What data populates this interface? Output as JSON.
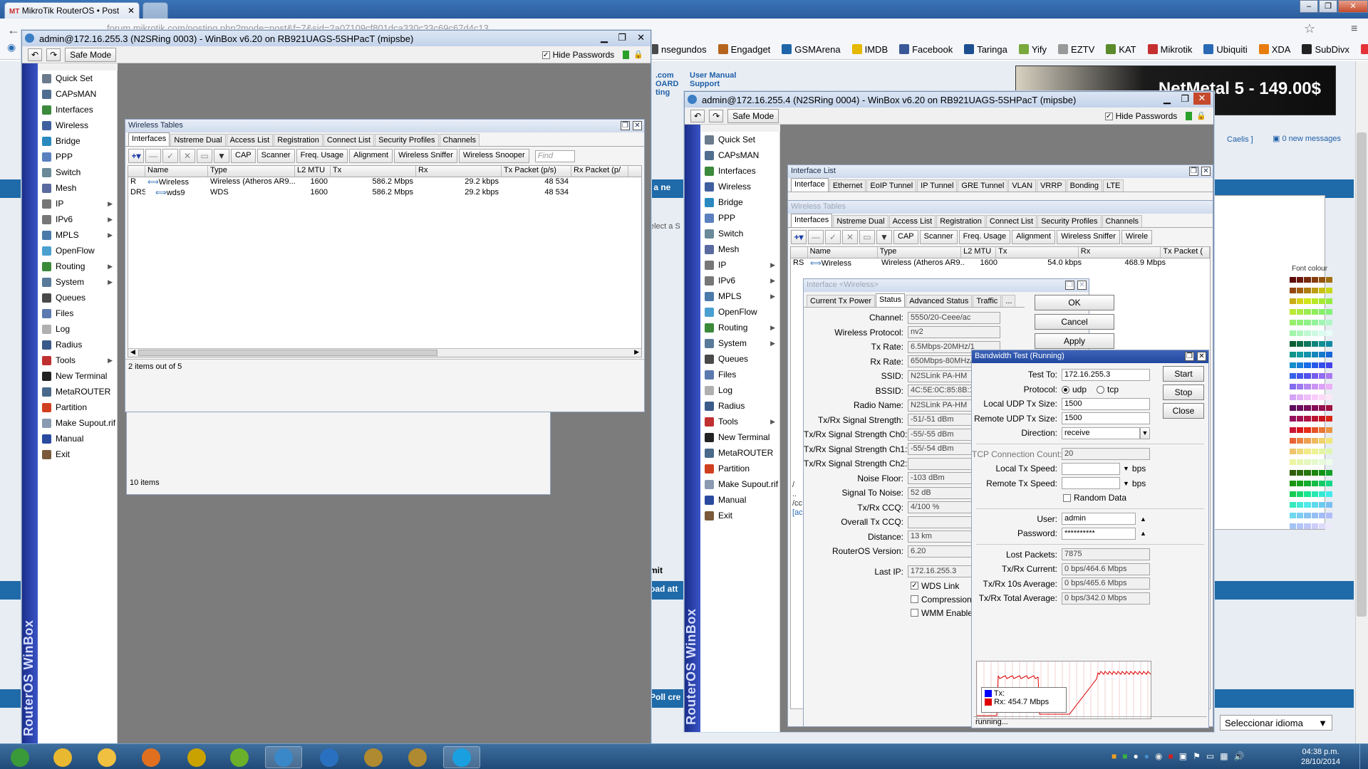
{
  "browser": {
    "tabs": [
      {
        "label": "MikroTik RouterOS • Post"
      }
    ],
    "url_partial": "forum.mikrotik.com/posting.php?mode=post&f=7&sid=2a07109cf801dca330c33c69c67d4c13",
    "bookmarks": [
      "nsegundos",
      "Engadget",
      "GSMArena",
      "IMDB",
      "Facebook",
      "Taringa",
      "Yify",
      "EZTV",
      "KAT",
      "Mikrotik",
      "Ubiquiti",
      "XDA",
      "SubDivx",
      "eBay"
    ],
    "bookmark_colors": [
      "#4a4a4a",
      "#b5651d",
      "#1f66a8",
      "#e6b800",
      "#3b5998",
      "#1d4f91",
      "#79a83c",
      "#999",
      "#5a8a2a",
      "#c62f2f",
      "#2a6ab5",
      "#e87d0d",
      "#222",
      "#e53238"
    ]
  },
  "webpage": {
    "links": [
      ".com",
      "OARD",
      "ting",
      "User Manual",
      "Support"
    ],
    "banner_text": "NetMetal 5 - 149.00$",
    "right_header": "Caelis ]",
    "messages": "0 new messages",
    "font_colour_label": "Font colour",
    "left_fragments": [
      "t a ne",
      "elect a S",
      "mit",
      "oad att",
      "Poll cre"
    ],
    "language_select": "Seleccionar idioma"
  },
  "winbox1": {
    "title": "admin@172.16.255.3 (N2SRing 0003) - WinBox v6.20 on RB921UAGS-5SHPacT (mipsbe)",
    "safe_mode": "Safe Mode",
    "hide_passwords": "Hide Passwords",
    "side_label": "RouterOS WinBox",
    "bg_window_status": "10 items"
  },
  "winbox2": {
    "title": "admin@172.16.255.4 (N2SRing 0004) - WinBox v6.20 on RB921UAGS-5SHPacT (mipsbe)",
    "safe_mode": "Safe Mode",
    "hide_passwords": "Hide Passwords",
    "side_label": "RouterOS WinBox"
  },
  "menu_items": [
    {
      "label": "Quick Set",
      "icon": "quick-set-icon",
      "color": "#6b7b8c",
      "arrow": false
    },
    {
      "label": "CAPsMAN",
      "icon": "capsman-icon",
      "color": "#4f6d8f",
      "arrow": false
    },
    {
      "label": "Interfaces",
      "icon": "interfaces-icon",
      "color": "#3c8a3c",
      "arrow": false
    },
    {
      "label": "Wireless",
      "icon": "wireless-icon",
      "color": "#3f5f9f",
      "arrow": false
    },
    {
      "label": "Bridge",
      "icon": "bridge-icon",
      "color": "#2a8ac0",
      "arrow": false
    },
    {
      "label": "PPP",
      "icon": "ppp-icon",
      "color": "#5a80c0",
      "arrow": false
    },
    {
      "label": "Switch",
      "icon": "switch-icon",
      "color": "#6a8a9a",
      "arrow": false
    },
    {
      "label": "Mesh",
      "icon": "mesh-icon",
      "color": "#5a6aa0",
      "arrow": false
    },
    {
      "label": "IP",
      "icon": "ip-icon",
      "color": "#777777",
      "arrow": true
    },
    {
      "label": "IPv6",
      "icon": "ipv6-icon",
      "color": "#777777",
      "arrow": true
    },
    {
      "label": "MPLS",
      "icon": "mpls-icon",
      "color": "#4a7aaa",
      "arrow": true
    },
    {
      "label": "OpenFlow",
      "icon": "openflow-icon",
      "color": "#4aa0d0",
      "arrow": false
    },
    {
      "label": "Routing",
      "icon": "routing-icon",
      "color": "#3a8a3a",
      "arrow": true
    },
    {
      "label": "System",
      "icon": "system-icon",
      "color": "#5a7a9a",
      "arrow": true
    },
    {
      "label": "Queues",
      "icon": "queues-icon",
      "color": "#4a4a4a",
      "arrow": false
    },
    {
      "label": "Files",
      "icon": "files-icon",
      "color": "#5a7ab0",
      "arrow": false
    },
    {
      "label": "Log",
      "icon": "log-icon",
      "color": "#b0b0b0",
      "arrow": false
    },
    {
      "label": "Radius",
      "icon": "radius-icon",
      "color": "#3a5a8a",
      "arrow": false
    },
    {
      "label": "Tools",
      "icon": "tools-icon",
      "color": "#c03030",
      "arrow": true
    },
    {
      "label": "New Terminal",
      "icon": "terminal-icon",
      "color": "#222222",
      "arrow": false
    },
    {
      "label": "MetaROUTER",
      "icon": "metarouter-icon",
      "color": "#4a6a8a",
      "arrow": false
    },
    {
      "label": "Partition",
      "icon": "partition-icon",
      "color": "#d04020",
      "arrow": false
    },
    {
      "label": "Make Supout.rif",
      "icon": "supout-icon",
      "color": "#8a9ab0",
      "arrow": false
    },
    {
      "label": "Manual",
      "icon": "manual-icon",
      "color": "#2a4aa0",
      "arrow": false
    },
    {
      "label": "Exit",
      "icon": "exit-icon",
      "color": "#7a5a3a",
      "arrow": false
    }
  ],
  "wireless_tables_1": {
    "title": "Wireless Tables",
    "tabs": [
      "Interfaces",
      "Nstreme Dual",
      "Access List",
      "Registration",
      "Connect List",
      "Security Profiles",
      "Channels"
    ],
    "toolbar": [
      "CAP",
      "Scanner",
      "Freq. Usage",
      "Alignment",
      "Wireless Sniffer",
      "Wireless Snooper"
    ],
    "find_placeholder": "Find",
    "columns": [
      "Name",
      "Type",
      "L2 MTU",
      "Tx",
      "Rx",
      "Tx Packet (p/s)",
      "Rx Packet (p/"
    ],
    "rows": [
      {
        "flag": "R",
        "name": "Wireless",
        "type": "Wireless (Atheros AR9...",
        "mtu": "1600",
        "tx": "586.2 Mbps",
        "rx": "29.2 kbps",
        "txp": "48 534"
      },
      {
        "flag": "DRS",
        "name": "wds9",
        "type": "WDS",
        "mtu": "1600",
        "tx": "586.2 Mbps",
        "rx": "29.2 kbps",
        "txp": "48 534"
      }
    ],
    "status": "2 items out of 5"
  },
  "interface_list": {
    "title": "Interface List",
    "tabs": [
      "Interface",
      "Ethernet",
      "EoIP Tunnel",
      "IP Tunnel",
      "GRE Tunnel",
      "VLAN",
      "VRRP",
      "Bonding",
      "LTE"
    ]
  },
  "wireless_tables_2": {
    "title": "Wireless Tables",
    "tabs": [
      "Interfaces",
      "Nstreme Dual",
      "Access List",
      "Registration",
      "Connect List",
      "Security Profiles",
      "Channels"
    ],
    "toolbar": [
      "CAP",
      "Scanner",
      "Freq. Usage",
      "Alignment",
      "Wireless Sniffer",
      "Wirele"
    ],
    "columns": [
      "Name",
      "Type",
      "L2 MTU",
      "Tx",
      "Rx",
      "Tx Packet ("
    ],
    "row": {
      "flag": "RS",
      "name": "Wireless",
      "type": "Wireless (Atheros AR9...",
      "mtu": "1600",
      "tx": "54.0 kbps",
      "rx": "468.9 Mbps"
    }
  },
  "interface_wireless": {
    "title": "Interface <Wireless>",
    "tabs": [
      "Current Tx Power",
      "Status",
      "Advanced Status",
      "Traffic",
      "..."
    ],
    "buttons": [
      "OK",
      "Cancel",
      "Apply"
    ],
    "fields": [
      {
        "label": "Channel:",
        "value": "5550/20-Ceee/ac"
      },
      {
        "label": "Wireless Protocol:",
        "value": "nv2"
      },
      {
        "label": "Tx Rate:",
        "value": "6.5Mbps-20MHz/1"
      },
      {
        "label": "Rx Rate:",
        "value": "650Mbps-80MHz/2"
      },
      {
        "label": "SSID:",
        "value": "N2SLink PA-HM"
      },
      {
        "label": "BSSID:",
        "value": "4C:5E:0C:85:8B:1E"
      },
      {
        "label": "Radio Name:",
        "value": "N2SLink PA-HM"
      },
      {
        "label": "Tx/Rx Signal Strength:",
        "value": "-51/-51 dBm"
      },
      {
        "label": "Tx/Rx Signal Strength Ch0:",
        "value": "-55/-55 dBm"
      },
      {
        "label": "Tx/Rx Signal Strength Ch1:",
        "value": "-55/-54 dBm"
      },
      {
        "label": "Tx/Rx Signal Strength Ch2:",
        "value": ""
      },
      {
        "label": "Noise Floor:",
        "value": "-103 dBm"
      },
      {
        "label": "Signal To Noise:",
        "value": "52 dB"
      },
      {
        "label": "Tx/Rx CCQ:",
        "value": "4/100 %"
      },
      {
        "label": "Overall Tx CCQ:",
        "value": ""
      },
      {
        "label": "Distance:",
        "value": "13 km"
      },
      {
        "label": "RouterOS Version:",
        "value": "6.20"
      }
    ],
    "last_ip_label": "Last IP:",
    "last_ip": "172.16.255.3",
    "checks": [
      {
        "label": "WDS Link",
        "checked": true
      },
      {
        "label": "Compression",
        "checked": false
      },
      {
        "label": "WMM Enabled",
        "checked": false
      }
    ]
  },
  "bandwidth_test": {
    "title": "Bandwidth Test (Running)",
    "buttons": [
      "Start",
      "Stop",
      "Close"
    ],
    "test_to_label": "Test To:",
    "test_to": "172.16.255.3",
    "protocol_label": "Protocol:",
    "protocol_udp": "udp",
    "protocol_tcp": "tcp",
    "local_udp_label": "Local UDP Tx Size:",
    "local_udp": "1500",
    "remote_udp_label": "Remote UDP Tx Size:",
    "remote_udp": "1500",
    "direction_label": "Direction:",
    "direction": "receive",
    "tcp_count_label": "TCP Connection Count:",
    "tcp_count": "20",
    "local_speed_label": "Local Tx Speed:",
    "remote_speed_label": "Remote Tx Speed:",
    "bps": "bps",
    "random_data": "Random Data",
    "user_label": "User:",
    "user": "admin",
    "password_label": "Password:",
    "password": "**********",
    "lost_packets_label": "Lost Packets:",
    "lost_packets": "7875",
    "current_label": "Tx/Rx Current:",
    "current": "0 bps/464.6 Mbps",
    "avg10_label": "Tx/Rx 10s Average:",
    "avg10": "0 bps/465.6 Mbps",
    "total_label": "Tx/Rx Total Average:",
    "total": "0 bps/342.0 Mbps",
    "legend_tx": "Tx:",
    "legend_rx": "Rx:",
    "legend_rx_value": "454.7 Mbps",
    "status": "running...",
    "colors": {
      "tx": "#0000ff",
      "rx": "#e00000"
    }
  },
  "terminal_fragments": [
    "/",
    "..",
    "/cc",
    "[ac"
  ],
  "taskbar": {
    "apps": [
      "start-orb",
      "chrome",
      "explorer",
      "media-player",
      "winbox-app",
      "utorrent",
      "connection-app",
      "browser-2",
      "league-1",
      "league-2",
      "skype"
    ],
    "clock_time": "04:38 p.m.",
    "clock_date": "28/10/2014"
  }
}
